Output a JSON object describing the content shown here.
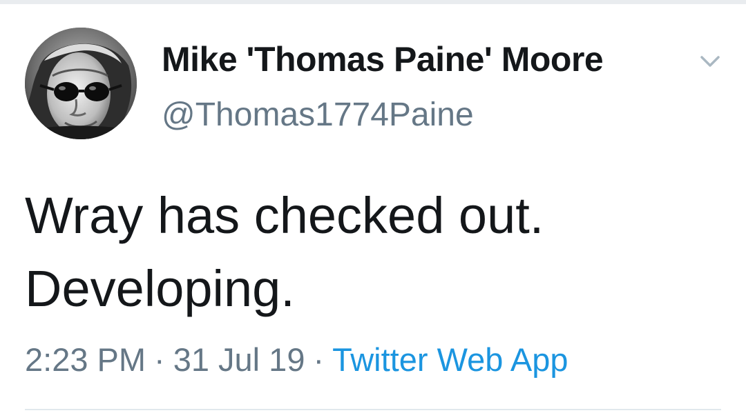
{
  "tweet": {
    "display_name": "Mike 'Thomas Paine' Moore",
    "handle": "@Thomas1774Paine",
    "text_lines": [
      "Wray has checked out.",
      "Developing."
    ],
    "time": "2:23 PM",
    "date": "31 Jul 19",
    "separator": "·",
    "source": "Twitter Web App"
  },
  "icons": {
    "avatar": "avatar-portrait-with-sunglasses",
    "menu": "chevron-down-icon"
  },
  "colors": {
    "name_text": "#14171a",
    "secondary_text": "#657786",
    "link": "#1b95e0",
    "divider": "#e1e8ed"
  }
}
